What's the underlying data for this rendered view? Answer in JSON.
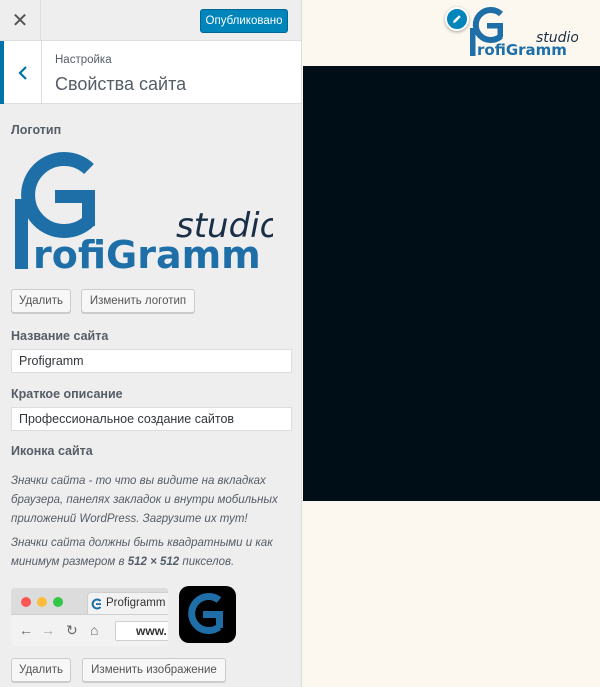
{
  "topbar": {
    "close_icon": "close-icon",
    "publish_label": "Опубликовано"
  },
  "section_header": {
    "back_icon": "chevron-left-icon",
    "breadcrumb": "Настройка",
    "title": "Свойства сайта"
  },
  "logo": {
    "label": "Логотип",
    "image": {
      "word_studio": "studio",
      "word_main": "rofiGramm"
    },
    "remove_label": "Удалить",
    "change_label": "Изменить логотип"
  },
  "site_title": {
    "label": "Название сайта",
    "value": "Profigramm"
  },
  "tagline": {
    "label": "Краткое описание",
    "value": "Профессиональное создание сайтов"
  },
  "site_icon": {
    "label": "Иконка сайта",
    "desc1": "Значки сайта - то что вы видите на вкладках браузера, панелях закладок и внутри мобильных приложений WordPress. Загрузите их тут!",
    "desc2_before": "Значки сайта должны быть квадратными и как минимум размером в ",
    "desc2_size": "512 × 512",
    "desc2_after": " пикселов.",
    "browser_tab_title": "Profigramm",
    "browser_url": "www.",
    "remove_label": "Удалить",
    "change_label": "Изменить изображение"
  },
  "preview": {
    "edit_icon": "pencil-icon",
    "logo_text_studio": "studio",
    "logo_text_main": "rofiGramm"
  },
  "colors": {
    "accent": "#0085ba",
    "brand_blue": "#1e6fa8",
    "preview_dark": "#000e17",
    "preview_light": "#fdf8ef"
  }
}
